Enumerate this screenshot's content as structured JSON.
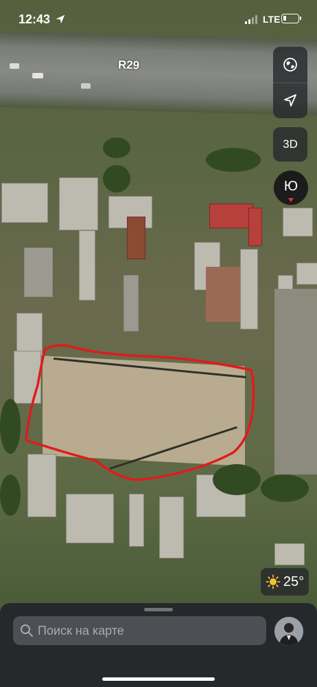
{
  "status_bar": {
    "time": "12:43",
    "network": "LTE",
    "icons": [
      "location-arrow-icon",
      "signal-bars-icon",
      "battery-icon"
    ]
  },
  "map": {
    "road_label": "R29",
    "controls": {
      "globe_icon": "globe-icon",
      "locate_icon": "location-arrow-icon",
      "view_3d_label": "3D",
      "compass_letter": "Ю"
    },
    "weather": {
      "icon": "sun-icon",
      "temperature": "25°"
    },
    "colors": {
      "highlight_outline": "#e11b1b",
      "compass_needle": "#e0333a"
    }
  },
  "bottom_sheet": {
    "search_placeholder": "Поиск на карте",
    "search_icon": "search-icon",
    "avatar": "user-avatar"
  }
}
